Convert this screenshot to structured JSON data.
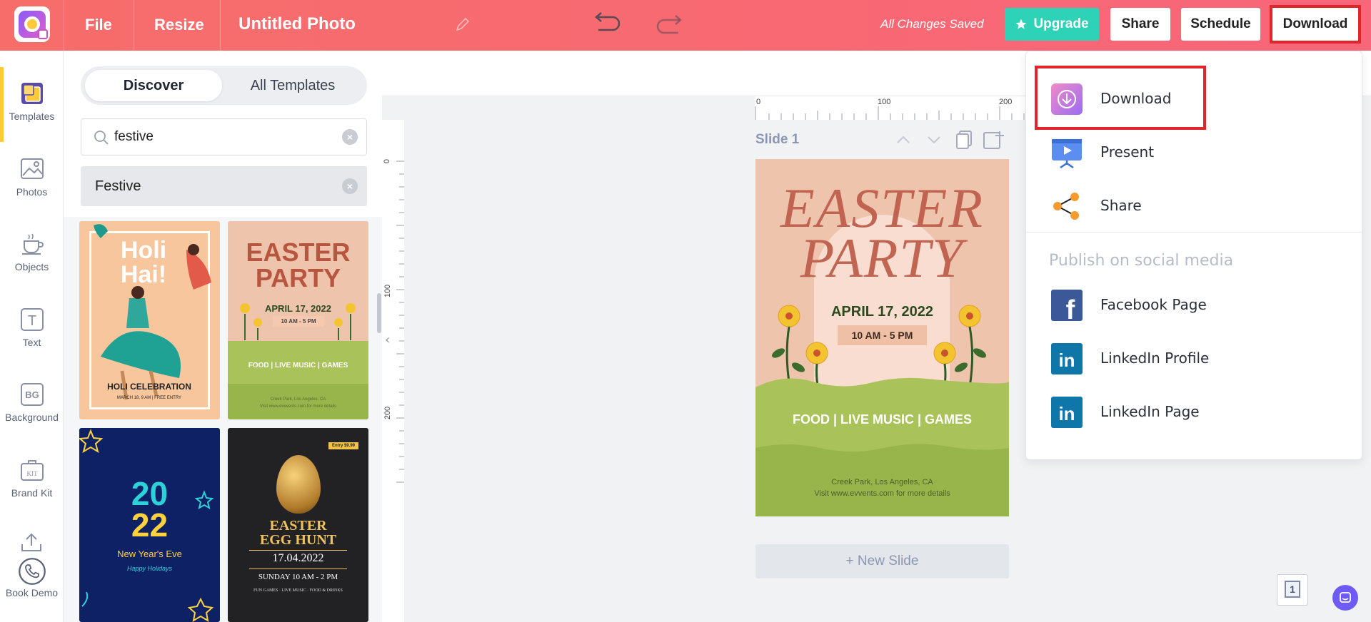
{
  "app": {
    "title": "Untitled Photo",
    "status": "All Changes Saved",
    "menu": {
      "file": "File",
      "resize": "Resize"
    },
    "buttons": {
      "upgrade": "Upgrade",
      "share": "Share",
      "schedule": "Schedule",
      "download": "Download"
    }
  },
  "rail": {
    "items": [
      {
        "label": "Templates",
        "icon": "templates-icon"
      },
      {
        "label": "Photos",
        "icon": "photos-icon"
      },
      {
        "label": "Objects",
        "icon": "objects-icon"
      },
      {
        "label": "Text",
        "icon": "text-icon"
      },
      {
        "label": "Background",
        "icon": "background-icon"
      },
      {
        "label": "Brand Kit",
        "icon": "brand-kit-icon"
      },
      {
        "label": "Book Demo",
        "icon": "phone-icon"
      }
    ],
    "bg_glyph": "BG",
    "kit_glyph": "KIT",
    "text_glyph": "T"
  },
  "panel": {
    "tabs": {
      "discover": "Discover",
      "all": "All Templates"
    },
    "search_value": "festive",
    "chip": "Festive",
    "clear_glyph": "×"
  },
  "templates": {
    "holi": {
      "title1": "Holi",
      "title2": "Hai!",
      "caption": "HOLI CELEBRATION",
      "sub": "MARCH 18, 9 AM | FREE ENTRY"
    },
    "easter": {
      "t1": "EASTER",
      "t2": "PARTY",
      "date": "APRIL 17, 2022",
      "time": "10 AM - 5 PM",
      "food": "FOOD | LIVE MUSIC | GAMES",
      "addr1": "Creek Park, Los Angeles, CA",
      "addr2": "Visit www.evevents.com for more details"
    },
    "newyear": {
      "y1": "20",
      "y2": "22",
      "line": "New Year's Eve",
      "sub": "Happy Holidays"
    },
    "egghunt": {
      "tag": "Entry $9.99",
      "l1": "EASTER",
      "l2": "EGG HUNT",
      "date": "17.04.2022",
      "time": "SUNDAY 10 AM - 2 PM",
      "sub": "FUN GAMES · LIVE MUSIC · FOOD & DRINKS"
    }
  },
  "canvas": {
    "slide_label": "Slide 1",
    "new_slide": "+ New Slide",
    "page_number": "1",
    "ruler": {
      "h0": "0",
      "h100": "100",
      "h200": "200",
      "v0": "0",
      "v100": "100",
      "v200": "200"
    },
    "collapse_glyph": "‹",
    "slide": {
      "title1": "EASTER",
      "title2": "PARTY",
      "date": "APRIL 17, 2022",
      "time": "10 AM - 5 PM",
      "food": "FOOD | LIVE MUSIC | GAMES",
      "addr1": "Creek Park, Los Angeles, CA",
      "addr2": "Visit www.evvents.com for more details"
    }
  },
  "dropdown": {
    "items": [
      {
        "label": "Download",
        "icon": "download-icon"
      },
      {
        "label": "Present",
        "icon": "present-icon"
      },
      {
        "label": "Share",
        "icon": "share-icon"
      }
    ],
    "social_heading": "Publish on social media",
    "social": [
      {
        "label": "Facebook Page",
        "icon": "facebook-icon"
      },
      {
        "label": "LinkedIn Profile",
        "icon": "linkedin-icon"
      },
      {
        "label": "LinkedIn Page",
        "icon": "linkedin-icon"
      }
    ],
    "fb_glyph": "f",
    "in_glyph": "in"
  },
  "colors": {
    "topbar": "#f76d6a",
    "upgrade": "#2ed3b7",
    "highlight": "#e0262b",
    "rail_active": "#ffc93c"
  }
}
